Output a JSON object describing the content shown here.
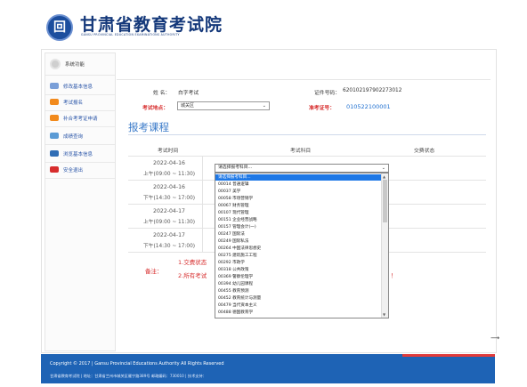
{
  "header": {
    "logo_glyph": "回",
    "title": "甘肃省教育考试院",
    "subtitle": "GANSU PROVINCIAL EDUCATION EXAMINATIONS AUTHORITY"
  },
  "sidebar": {
    "heading": "系统功能",
    "items": [
      {
        "label": "修改基本信息",
        "icon": "edit-icon",
        "color": "#7a9fd8"
      },
      {
        "label": "考试报名",
        "icon": "register-icon",
        "color": "#f28a1c"
      },
      {
        "label": "补合考考证申请",
        "icon": "apply-icon",
        "color": "#f28a1c"
      },
      {
        "label": "成绩查询",
        "icon": "score-icon",
        "color": "#5b9bd5"
      },
      {
        "label": "浏览基本信息",
        "icon": "info-icon",
        "color": "#2f6db5"
      },
      {
        "label": "安全退出",
        "icon": "exit-icon",
        "color": "#d72d2d"
      }
    ]
  },
  "form": {
    "name_label": "姓 名：",
    "name_value": "白字考试",
    "id_label": "证件号码：",
    "id_value": "620102197902273012",
    "location_label": "考试地点：",
    "location_value": "城关区",
    "ticket_label": "准考证号：",
    "ticket_value": "010522100001"
  },
  "section": {
    "title": "报考课程",
    "col_time": "考试时间",
    "col_subject": "考试科目",
    "col_status": "交费状态"
  },
  "sessions": [
    {
      "date": "2022-04-16",
      "time": "上午(09:00 ~ 11:30)"
    },
    {
      "date": "2022-04-16",
      "time": "下午(14:30 ~ 17:00)"
    },
    {
      "date": "2022-04-17",
      "time": "上午(09:00 ~ 11:30)"
    },
    {
      "date": "2022-04-17",
      "time": "下午(14:30 ~ 17:00)"
    }
  ],
  "dropdown": {
    "current": "请选择报考科目...",
    "options": [
      "请选择报考科目...",
      "00014 普通逻辑",
      "00037 美学",
      "00058 市场营销学",
      "00067 财务管理",
      "00107 现代管理",
      "00151 企业经营战略",
      "00157 管理会计(一)",
      "00247 国际法",
      "00249 国际私法",
      "00264 中国法律思想史",
      "00275 建筑施工工程",
      "00292 市政学",
      "00318 公共政策",
      "00369 警察伦理学",
      "00394 幼儿园课程",
      "00455 教育预测",
      "00452 教育统计与测量",
      "00479 当代资本主义",
      "00488 德国教育学"
    ]
  },
  "notes": {
    "label": "备注：",
    "line1": "1.交费状态",
    "line2": "2.所有考试",
    "tail": "！"
  },
  "footer": {
    "copyright": "Copyright © 2017 | Gansu Provincial Educations Authority All Rights Reserved",
    "address": "甘肃省教育考试院 | 地址：甘肃省兰州市城关区雁宁路389号 邮政编码：730010 | 技术支持："
  },
  "colors": {
    "brand_blue": "#14387a",
    "footer_blue": "#1e63b5",
    "accent_red": "#d72d2d",
    "link_blue": "#1e6fd0"
  }
}
